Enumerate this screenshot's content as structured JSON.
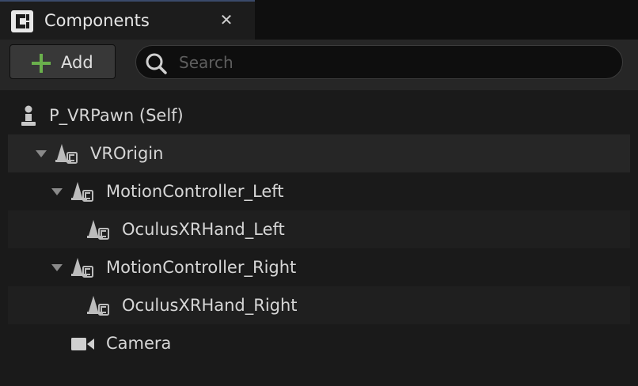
{
  "tab": {
    "title": "Components",
    "close_glyph": "✕",
    "icon": "components-blueprint-icon"
  },
  "toolbar": {
    "add_label": "Add",
    "add_icon": "plus-icon",
    "search_placeholder": "Search",
    "search_value": "",
    "search_icon": "search-icon"
  },
  "tree": {
    "items": [
      {
        "label": "P_VRPawn (Self)",
        "icon": "pawn-icon",
        "depth": 0,
        "expandable": false
      },
      {
        "label": "VROrigin",
        "icon": "scene-component-icon",
        "depth": 1,
        "expandable": true,
        "expanded": true,
        "selected": true
      },
      {
        "label": "MotionController_Left",
        "icon": "scene-component-icon",
        "depth": 2,
        "expandable": true,
        "expanded": true
      },
      {
        "label": "OculusXRHand_Left",
        "icon": "scene-component-icon",
        "depth": 3,
        "expandable": false
      },
      {
        "label": "MotionController_Right",
        "icon": "scene-component-icon",
        "depth": 2,
        "expandable": true,
        "expanded": true
      },
      {
        "label": "OculusXRHand_Right",
        "icon": "scene-component-icon",
        "depth": 3,
        "expandable": false
      },
      {
        "label": "Camera",
        "icon": "camera-icon",
        "depth": 2,
        "expandable": false
      }
    ]
  },
  "colors": {
    "background": "#1a1a1a",
    "toolbar": "#262626",
    "add_plus": "#6ab04c",
    "text": "#d6d6d6"
  }
}
